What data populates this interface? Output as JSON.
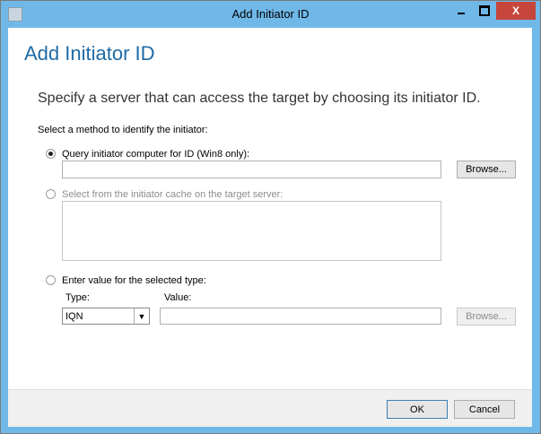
{
  "window": {
    "title": "Add Initiator ID",
    "close_symbol": "X"
  },
  "dialog": {
    "heading": "Add Initiator ID",
    "instruction": "Specify a server that can access the target by choosing its initiator ID.",
    "method_label": "Select a method to identify the initiator:",
    "options": {
      "query": {
        "label": "Query initiator computer for ID (Win8 only):",
        "value": "",
        "browse_label": "Browse..."
      },
      "cache": {
        "label": "Select from the initiator cache on the target server:"
      },
      "enter": {
        "label": "Enter value for the selected type:",
        "type_label": "Type:",
        "type_value": "IQN",
        "value_label": "Value:",
        "value": "",
        "browse_label": "Browse..."
      }
    }
  },
  "footer": {
    "ok_label": "OK",
    "cancel_label": "Cancel"
  }
}
